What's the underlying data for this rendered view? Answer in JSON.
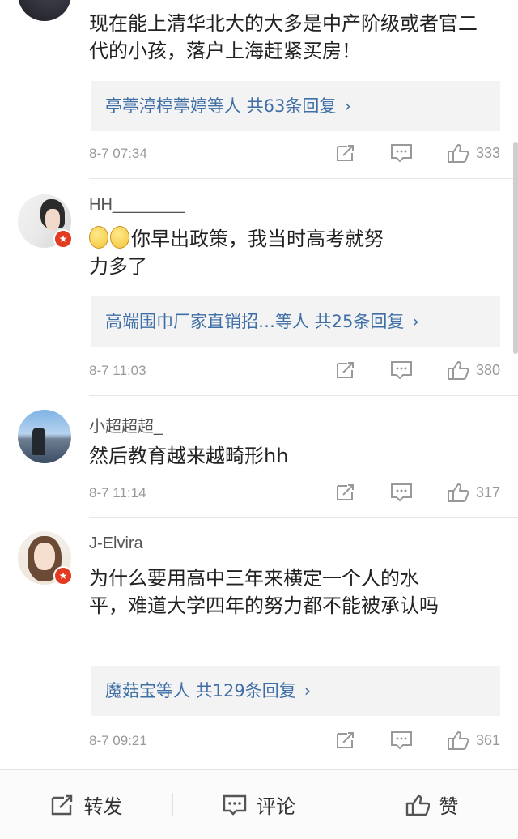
{
  "comments": [
    {
      "username": "",
      "text": "现在能上清华北大的大多是中产阶级或者官二代的小孩，落户上海赶紧买房！",
      "replies": "亭葶渟楟葶婷等人  共63条回复",
      "time": "8-7 07:34",
      "likes": "333"
    },
    {
      "username": "HH________",
      "text": "你早出政策，我当时高考就努力多了",
      "replies": "高端围巾厂家直销招…等人  共25条回复",
      "time": "8-7 11:03",
      "likes": "380"
    },
    {
      "username": "小超超超_",
      "text": "然后教育越来越畸形hh",
      "time": "8-7 11:14",
      "likes": "317"
    },
    {
      "username": "J-Elvira",
      "text": "为什么要用高中三年来横定一个人的水平，难道大学四年的努力都不能被承认吗",
      "replies": "魔菇宝等人  共129条回复",
      "time": "8-7 09:21",
      "likes": "361"
    }
  ],
  "icons": {
    "verified_badge": "verified-badge-icon",
    "forward": "forward-icon",
    "comment": "comment-icon",
    "like": "thumbs-up-icon",
    "chevron": "chevron-right-icon"
  },
  "bottom_bar": {
    "forward_label": "转发",
    "comment_label": "评论",
    "like_label": "赞"
  },
  "colors": {
    "link": "#3f6fa6",
    "meta": "#999999",
    "badge": "#e23b22",
    "reply_bg": "#f3f3f3"
  }
}
